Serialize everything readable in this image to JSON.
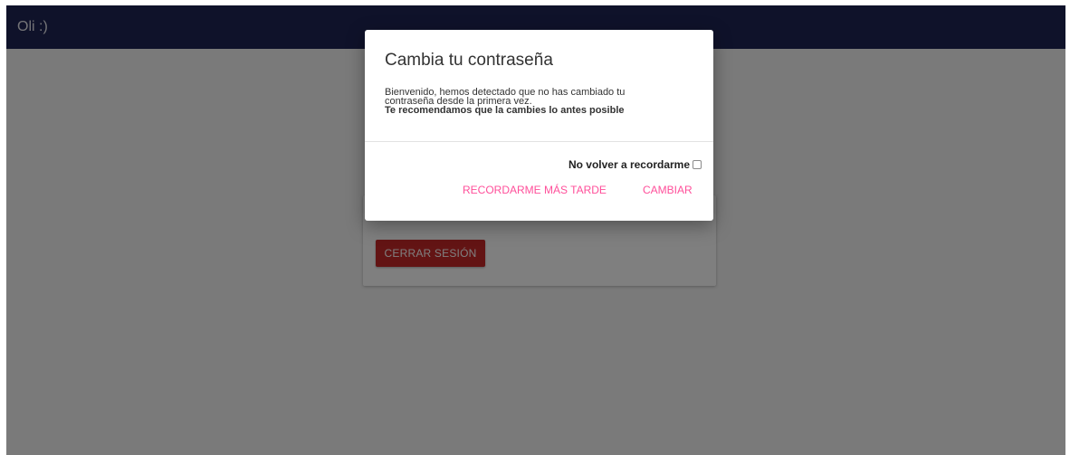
{
  "app": {
    "title": "Oli :)"
  },
  "card": {
    "logout_label": "CERRAR SESIÓN"
  },
  "modal": {
    "title": "Cambia tu contraseña",
    "message_line1": "Bienvenido, hemos detectado que no has cambiado tu",
    "message_line2": "contraseña desde la primera vez.",
    "message_strong": "Te recomendamos que la cambies lo antes posible",
    "dont_remind_label": "No volver a recordarme",
    "dont_remind_checked": false,
    "remind_later_label": "RECORDARME MÁS TARDE",
    "change_label": "CAMBIAR"
  },
  "colors": {
    "header": "#1f2555",
    "logout_button": "#c62828",
    "accent_link": "#ff4f9a",
    "overlay": "rgba(0,0,0,0.5)"
  }
}
